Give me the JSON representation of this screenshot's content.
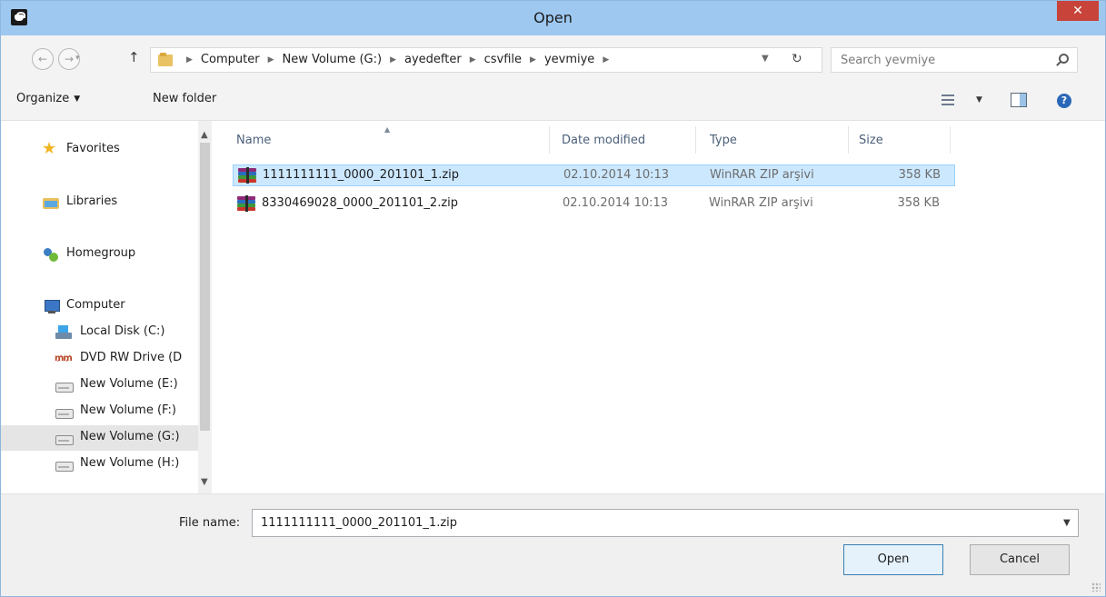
{
  "window": {
    "title": "Open"
  },
  "nav": {
    "back_glyph": "←",
    "forward_glyph": "→",
    "dropdown_glyph": "▾",
    "up_glyph": "↑",
    "breadcrumb": [
      "Computer",
      "New Volume (G:)",
      "ayedefter",
      "csvfile",
      "yevmiye"
    ],
    "refresh_glyph": "↻"
  },
  "search": {
    "placeholder": "Search yevmiye"
  },
  "toolbar": {
    "organize_label": "Organize",
    "new_folder_label": "New folder",
    "help_glyph": "?"
  },
  "sidebar": {
    "items": [
      {
        "label": "Favorites",
        "icon": "star-icon"
      },
      {
        "label": "Libraries",
        "icon": "libraries-icon"
      },
      {
        "label": "Homegroup",
        "icon": "homegroup-icon"
      },
      {
        "label": "Computer",
        "icon": "computer-icon"
      },
      {
        "label": "Local Disk (C:)",
        "icon": "local-disk-icon"
      },
      {
        "label": "DVD RW Drive (D",
        "icon": "dvd-drive-icon"
      },
      {
        "label": "New Volume (E:)",
        "icon": "drive-icon"
      },
      {
        "label": "New Volume (F:)",
        "icon": "drive-icon"
      },
      {
        "label": "New Volume (G:)",
        "icon": "drive-icon",
        "selected": true
      },
      {
        "label": "New Volume (H:)",
        "icon": "drive-icon"
      }
    ]
  },
  "filelist": {
    "columns": [
      "Name",
      "Date modified",
      "Type",
      "Size"
    ],
    "rows": [
      {
        "name": "1111111111_0000_201101_1.zip",
        "date": "02.10.2014 10:13",
        "type": "WinRAR ZIP arşivi",
        "size": "358 KB",
        "selected": true
      },
      {
        "name": "8330469028_0000_201101_2.zip",
        "date": "02.10.2014 10:13",
        "type": "WinRAR ZIP arşivi",
        "size": "358 KB",
        "selected": false
      }
    ]
  },
  "footer": {
    "file_name_label": "File name:",
    "file_name_value": "1111111111_0000_201101_1.zip",
    "open_label": "Open",
    "cancel_label": "Cancel"
  },
  "colors": {
    "titlebar": "#9ec8f0",
    "close": "#c8433a",
    "selection": "#cce8ff"
  }
}
